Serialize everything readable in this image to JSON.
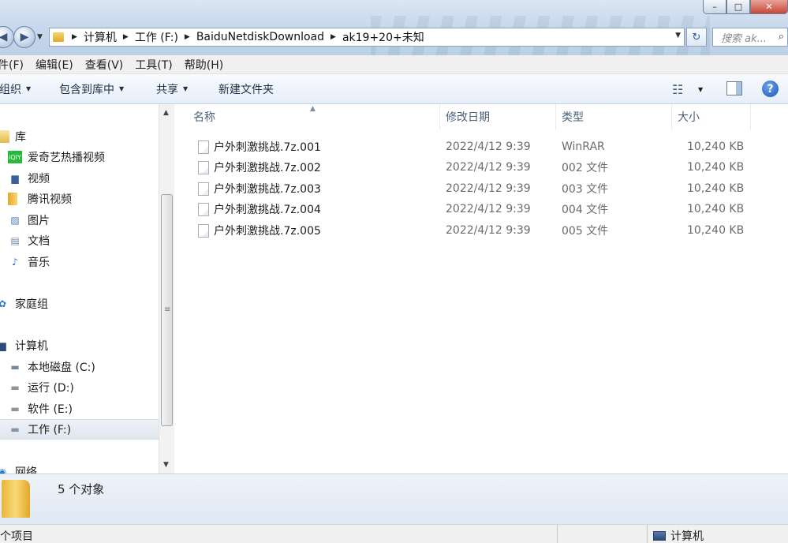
{
  "window": {
    "minimize_glyph": "–",
    "maximize_glyph": "□",
    "close_glyph": "✕"
  },
  "address": {
    "crumbs": [
      "计算机",
      "工作 (F:)",
      "BaiduNetdiskDownload",
      "ak19+20+未知"
    ],
    "search_placeholder": "搜索 ak..."
  },
  "menu": [
    "件(F)",
    "编辑(E)",
    "查看(V)",
    "工具(T)",
    "帮助(H)"
  ],
  "toolbar": {
    "organize": "组织",
    "include_library": "包含到库中",
    "share": "共享",
    "new_folder": "新建文件夹"
  },
  "sidebar": {
    "items": [
      {
        "label": "库",
        "icon": "library-icon"
      },
      {
        "label": "爱奇艺热播视频",
        "icon": "iqiyi-icon"
      },
      {
        "label": "视频",
        "icon": "video-library-icon"
      },
      {
        "label": "腾讯视频",
        "icon": "folder-icon"
      },
      {
        "label": "图片",
        "icon": "pictures-icon"
      },
      {
        "label": "文档",
        "icon": "documents-icon"
      },
      {
        "label": "音乐",
        "icon": "music-icon"
      },
      {
        "label": "家庭组",
        "icon": "homegroup-icon"
      },
      {
        "label": "计算机",
        "icon": "computer-icon"
      },
      {
        "label": "本地磁盘 (C:)",
        "icon": "local-disk-icon"
      },
      {
        "label": "运行 (D:)",
        "icon": "drive-icon"
      },
      {
        "label": "软件 (E:)",
        "icon": "drive-icon"
      },
      {
        "label": "工作 (F:)",
        "icon": "drive-icon"
      },
      {
        "label": "网络",
        "icon": "network-icon"
      }
    ]
  },
  "columns": {
    "name": "名称",
    "date": "修改日期",
    "type": "类型",
    "size": "大小"
  },
  "files": [
    {
      "name": "户外刺激挑战.7z.001",
      "date": "2022/4/12 9:39",
      "type": "WinRAR",
      "size": "10,240 KB"
    },
    {
      "name": "户外刺激挑战.7z.002",
      "date": "2022/4/12 9:39",
      "type": "002 文件",
      "size": "10,240 KB"
    },
    {
      "name": "户外刺激挑战.7z.003",
      "date": "2022/4/12 9:39",
      "type": "003 文件",
      "size": "10,240 KB"
    },
    {
      "name": "户外刺激挑战.7z.004",
      "date": "2022/4/12 9:39",
      "type": "004 文件",
      "size": "10,240 KB"
    },
    {
      "name": "户外刺激挑战.7z.005",
      "date": "2022/4/12 9:39",
      "type": "005 文件",
      "size": "10,240 KB"
    }
  ],
  "details": {
    "count": "5 个对象"
  },
  "status": {
    "left": "个项目",
    "right": "计算机"
  }
}
